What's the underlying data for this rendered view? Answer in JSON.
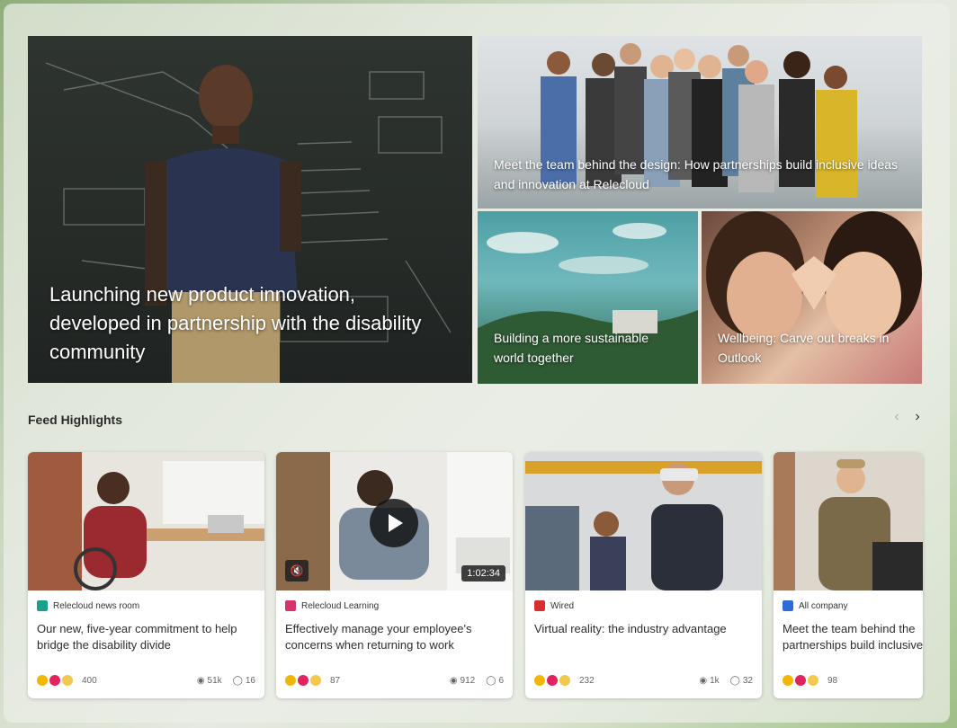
{
  "hero": {
    "main": {
      "title": "Launching new product innovation, developed in partnership with the disability community"
    },
    "team": {
      "title": "Meet the team behind the design: How partnerships build inclusive ideas and innovation at Relecloud"
    },
    "world": {
      "title": "Building a more sustainable world together"
    },
    "wellbeing": {
      "title": "Wellbeing: Carve out breaks in Outlook"
    }
  },
  "feed": {
    "section_title": "Feed Highlights",
    "prev_icon": "chevron-left-icon",
    "next_icon": "chevron-right-icon",
    "cards": [
      {
        "source": "Relecloud news room",
        "source_color": "#1b9e8a",
        "title": "Our new, five-year commitment to help bridge the disability divide",
        "reactions": "400",
        "views": "51k",
        "comments": "16"
      },
      {
        "source": "Relecloud Learning",
        "source_color": "#d6336c",
        "title": "Effectively manage your employee's concerns when returning to work",
        "reactions": "87",
        "views": "912",
        "comments": "6",
        "duration": "1:02:34"
      },
      {
        "source": "Wired",
        "source_color": "#d62f2f",
        "title": "Virtual reality: the industry advantage",
        "reactions": "232",
        "views": "1k",
        "comments": "32"
      },
      {
        "source": "All company",
        "source_color": "#2b6cd6",
        "title": "Meet the team behind the partnerships build inclusive",
        "reactions": "98"
      }
    ]
  },
  "colors": {
    "accent": "#2b2b2b",
    "card_bg": "#ffffff",
    "like": "#f2b705",
    "heart": "#e0245e"
  }
}
